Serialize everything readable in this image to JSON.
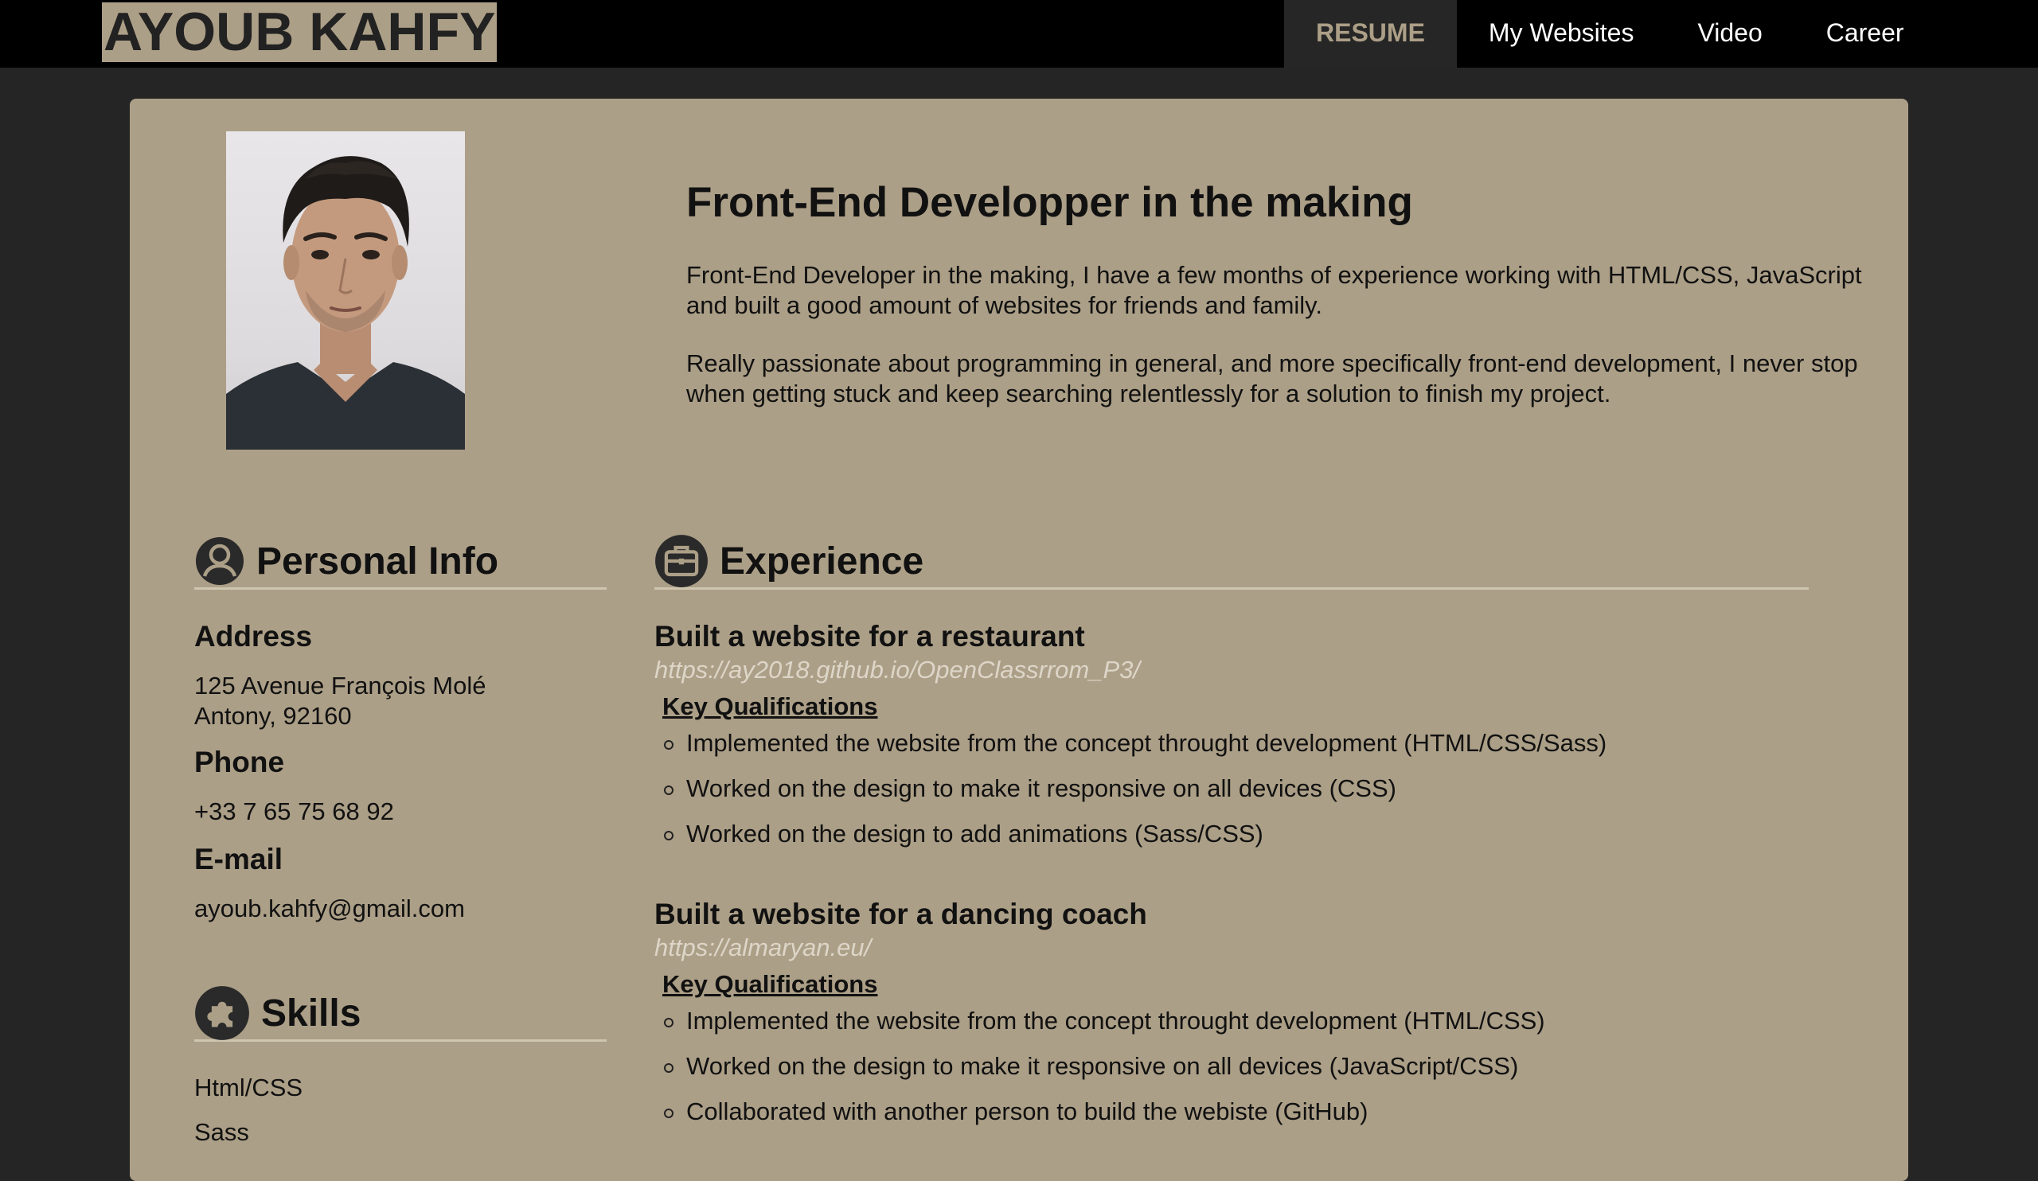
{
  "brand": "AYOUB KAHFY",
  "nav": [
    {
      "label": "RESUME",
      "active": true
    },
    {
      "label": "My Websites",
      "active": false
    },
    {
      "label": "Video",
      "active": false
    },
    {
      "label": "Career",
      "active": false
    }
  ],
  "intro": {
    "headline": "Front-End Developper in the making",
    "paragraphs": [
      "Front-End Developer in the making, I have a few months of experience working with HTML/CSS, JavaScript and built a good amount of websites for friends and family.",
      "Really passionate about programming in general, and more specifically front-end development, I never stop when getting stuck and keep searching relentlessly for a solution to finish my project."
    ]
  },
  "personal_info": {
    "title": "Personal Info",
    "icon": "user-icon",
    "address_label": "Address",
    "address_line1": "125 Avenue François Molé",
    "address_line2": "Antony, 92160",
    "phone_label": "Phone",
    "phone": "+33 7 65 75 68 92",
    "email_label": "E-mail",
    "email": "ayoub.kahfy@gmail.com"
  },
  "skills": {
    "title": "Skills",
    "icon": "puzzle-icon",
    "items": [
      "Html/CSS",
      "Sass"
    ]
  },
  "experience": {
    "title": "Experience",
    "icon": "briefcase-icon",
    "jobs": [
      {
        "title": "Built a website for a restaurant",
        "link": "https://ay2018.github.io/OpenClassrrom_P3/",
        "kq_label": "Key Qualifications",
        "items": [
          "Implemented the website from the concept throught development (HTML/CSS/Sass)",
          "Worked on the design to make it responsive on all devices (CSS)",
          "Worked on the design to add animations (Sass/CSS)"
        ]
      },
      {
        "title": "Built a website for a dancing coach",
        "link": "https://almaryan.eu/",
        "kq_label": "Key Qualifications",
        "items": [
          "Implemented the website from the concept throught development (HTML/CSS)",
          "Worked on the design to make it responsive on all devices (JavaScript/CSS)",
          "Collaborated with another person to build the webiste (GitHub)"
        ]
      }
    ]
  },
  "colors": {
    "accent": "#ac9f87",
    "topbar": "#000000",
    "page_bg": "#252525",
    "link": "#ddd6c8"
  }
}
